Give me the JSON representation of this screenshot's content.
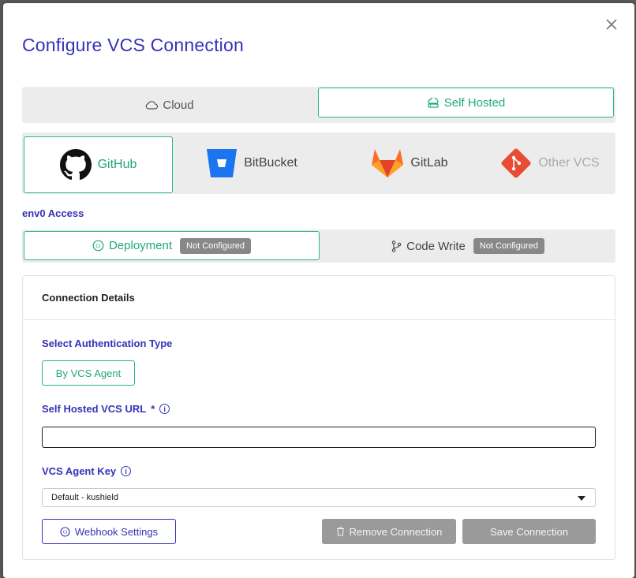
{
  "modal": {
    "title": "Configure VCS Connection"
  },
  "hosting": {
    "options": [
      {
        "label": "Cloud",
        "icon": "cloud-icon",
        "selected": false
      },
      {
        "label": "Self Hosted",
        "icon": "server-icon",
        "selected": true
      }
    ]
  },
  "providers": [
    {
      "label": "GitHub",
      "icon": "github-icon",
      "selected": true
    },
    {
      "label": "BitBucket",
      "icon": "bitbucket-icon",
      "selected": false
    },
    {
      "label": "GitLab",
      "icon": "gitlab-icon",
      "selected": false
    },
    {
      "label": "Other VCS",
      "icon": "git-icon",
      "selected": false,
      "disabled": true
    }
  ],
  "access": {
    "label": "env0 Access",
    "options": [
      {
        "label": "Deployment",
        "icon": "ci-icon",
        "badge": "Not Configured",
        "selected": true
      },
      {
        "label": "Code Write",
        "icon": "branch-icon",
        "badge": "Not Configured",
        "selected": false
      }
    ]
  },
  "details": {
    "header": "Connection Details",
    "auth_type_label": "Select Authentication Type",
    "auth_type_button": "By VCS Agent",
    "url_label": "Self Hosted VCS URL",
    "url_required": "*",
    "url_value": "",
    "agent_key_label": "VCS Agent Key",
    "agent_key_value": "Default - kushield",
    "webhook_button": "Webhook Settings",
    "remove_button": "Remove Connection",
    "save_button": "Save Connection"
  },
  "colors": {
    "accent_green": "#27b58c",
    "primary_blue": "#3632b8",
    "disabled_grey": "#9a9a9a"
  }
}
